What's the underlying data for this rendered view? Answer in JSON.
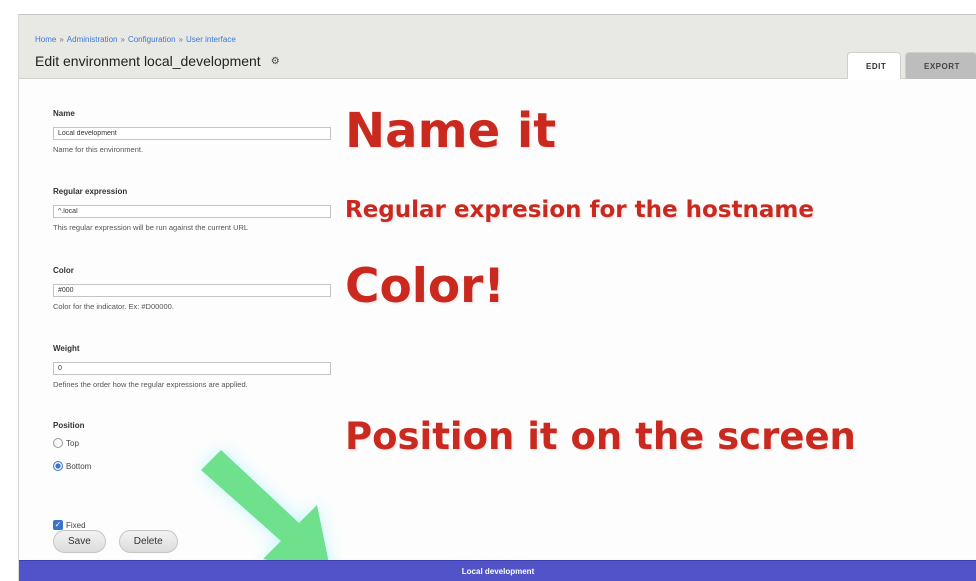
{
  "breadcrumb": [
    "Home",
    "Administration",
    "Configuration",
    "User interface"
  ],
  "page": {
    "title": "Edit environment local_development",
    "gear_glyph": "⚙"
  },
  "tabs": [
    {
      "label": "EDIT",
      "active": true
    },
    {
      "label": "EXPORT",
      "active": false
    }
  ],
  "form": {
    "name": {
      "label": "Name",
      "value": "Local development",
      "description": "Name for this environment."
    },
    "regex": {
      "label": "Regular expression",
      "value": "^.local",
      "description": "This regular expression will be run against the current URL"
    },
    "color": {
      "label": "Color",
      "value": "#000",
      "description": "Color for the indicator. Ex: #D00000."
    },
    "weight": {
      "label": "Weight",
      "value": "0",
      "description": "Defines the order how the regular expressions are applied."
    },
    "position": {
      "label": "Position",
      "options": [
        {
          "label": "Top",
          "checked": false
        },
        {
          "label": "Bottom",
          "checked": true
        }
      ]
    },
    "fixed": {
      "label": "Fixed",
      "checked": true
    }
  },
  "buttons": {
    "save": "Save",
    "delete": "Delete"
  },
  "annotations": {
    "name": "Name it",
    "regex": "Regular expresion for the hostname",
    "color": "Color!",
    "position": "Position it on the screen"
  },
  "indicator": {
    "label": "Local development",
    "color": "#5253c7"
  },
  "colors": {
    "annotation_text": "#c9291e",
    "arrow": "#6fe08c",
    "link": "#3a7bd5"
  }
}
